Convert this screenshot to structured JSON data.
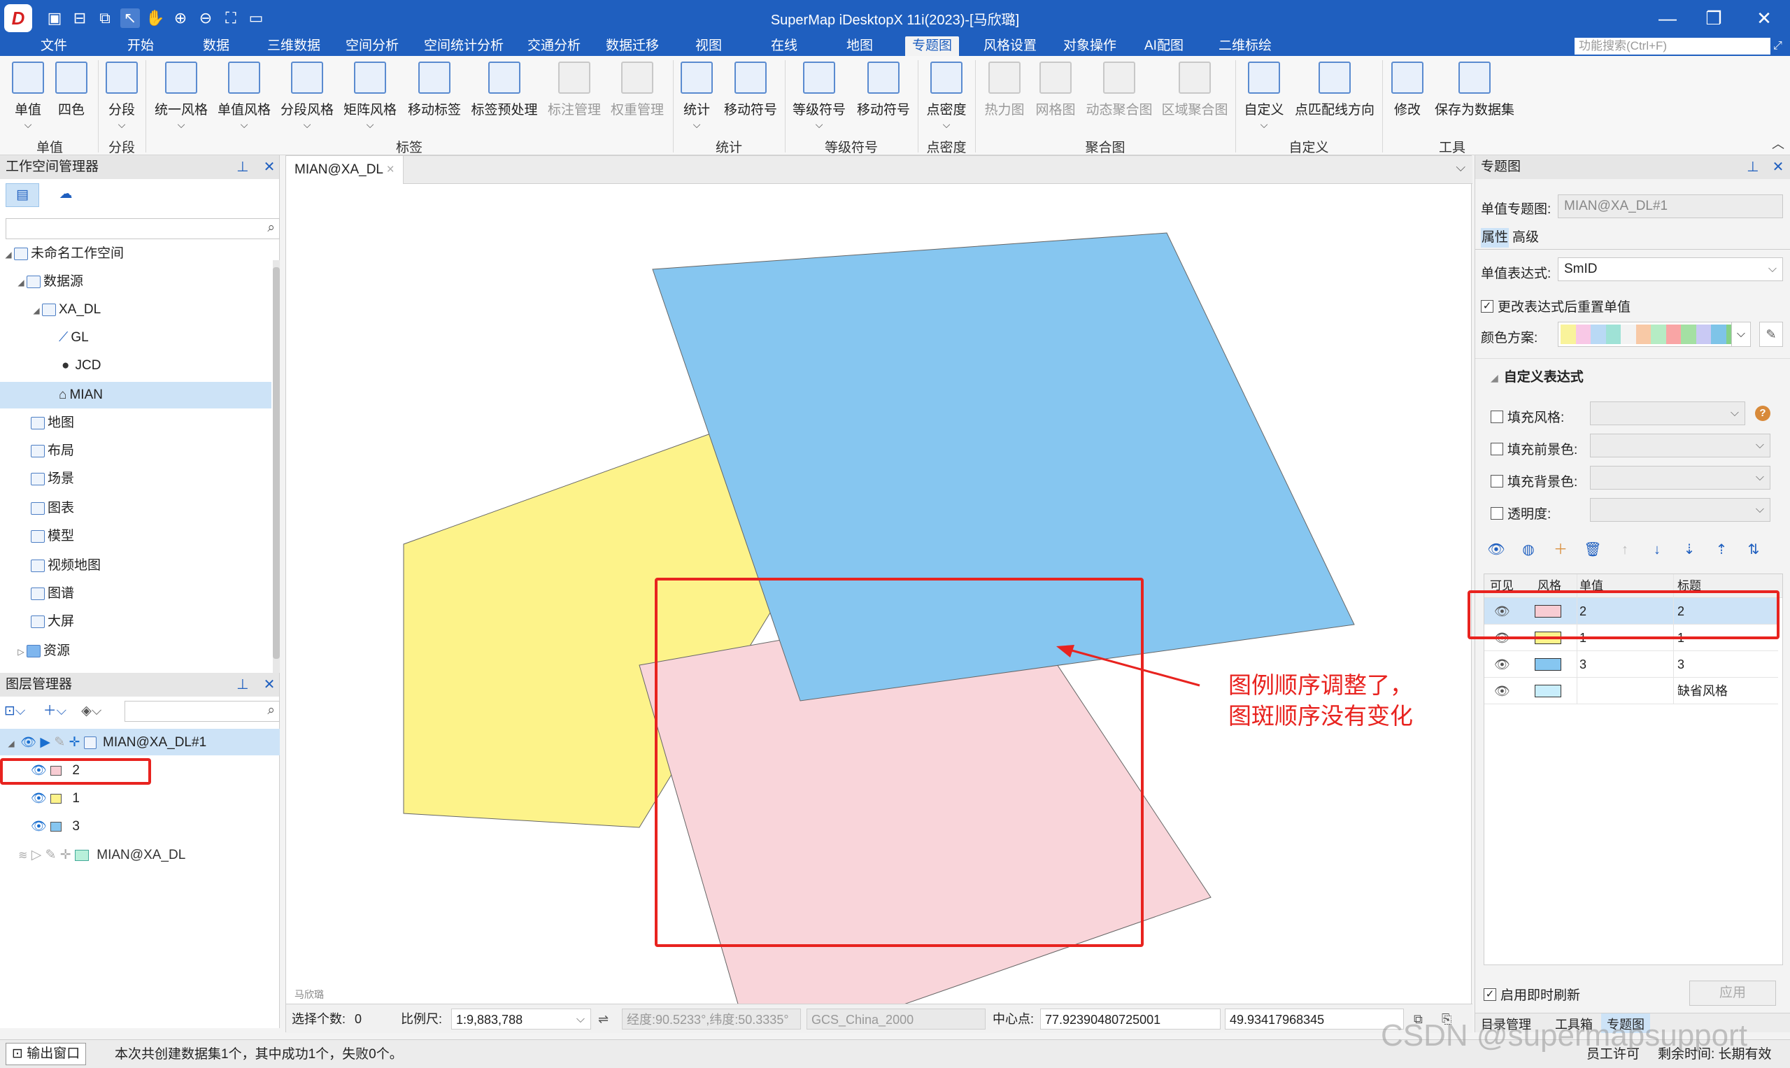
{
  "window": {
    "title": "SuperMap iDesktopX 11i(2023)-[马欣璐]",
    "logo": "D",
    "quick_access_icons": [
      "save-icon",
      "save-as-icon",
      "copy-icon",
      "select-icon",
      "pan-icon",
      "zoom-in-icon",
      "zoom-out-icon",
      "full-extent-icon",
      "open-folder-icon"
    ],
    "controls": {
      "minimize": "—",
      "maximize": "❐",
      "close": "✕"
    }
  },
  "menu": {
    "items": [
      "文件",
      "开始",
      "数据",
      "三维数据",
      "空间分析",
      "空间统计分析",
      "交通分析",
      "数据迁移",
      "视图",
      "在线",
      "地图",
      "专题图",
      "风格设置",
      "对象操作",
      "AI配图",
      "二维标绘"
    ],
    "active": "专题图",
    "search_placeholder": "功能搜索(Ctrl+F)"
  },
  "ribbon": {
    "buttons": [
      {
        "label": "单值",
        "icon": "unique-value-icon",
        "arrow": true
      },
      {
        "label": "四色",
        "icon": "four-color-icon",
        "arrow": false
      },
      {
        "label": "分段",
        "icon": "range-icon",
        "arrow": true
      },
      {
        "label": "统一风格",
        "icon": "uniform-label-icon",
        "arrow": true
      },
      {
        "label": "单值风格",
        "icon": "unique-label-icon",
        "arrow": true
      },
      {
        "label": "分段风格",
        "icon": "range-label-icon",
        "arrow": true
      },
      {
        "label": "矩阵风格",
        "icon": "matrix-label-icon",
        "arrow": true
      },
      {
        "label": "移动标签",
        "icon": "move-label-icon",
        "arrow": false
      },
      {
        "label": "标签预处理",
        "icon": "label-preprocess-icon",
        "arrow": false
      },
      {
        "label": "标注管理",
        "icon": "annotation-manage-icon",
        "arrow": false,
        "disabled": true
      },
      {
        "label": "权重管理",
        "icon": "weight-manage-icon",
        "arrow": false,
        "disabled": true
      },
      {
        "label": "统计",
        "icon": "graph-icon",
        "arrow": true
      },
      {
        "label": "移动符号",
        "icon": "move-graph-icon",
        "arrow": false
      },
      {
        "label": "等级符号",
        "icon": "graduated-symbol-icon",
        "arrow": true
      },
      {
        "label": "移动符号",
        "icon": "move-symbol-icon",
        "arrow": false
      },
      {
        "label": "点密度",
        "icon": "dot-density-icon",
        "arrow": true
      },
      {
        "label": "热力图",
        "icon": "heatmap-icon",
        "arrow": false,
        "disabled": true
      },
      {
        "label": "网格图",
        "icon": "grid-aggregation-icon",
        "arrow": false,
        "disabled": true
      },
      {
        "label": "动态聚合图",
        "icon": "dynamic-aggregation-icon",
        "arrow": false,
        "disabled": true
      },
      {
        "label": "区域聚合图",
        "icon": "region-aggregation-icon",
        "arrow": false,
        "disabled": true
      },
      {
        "label": "自定义",
        "icon": "custom-icon",
        "arrow": true
      },
      {
        "label": "点匹配线方向",
        "icon": "point-line-direction-icon",
        "arrow": false
      },
      {
        "label": "修改",
        "icon": "modify-icon",
        "arrow": false
      },
      {
        "label": "保存为数据集",
        "icon": "save-dataset-icon",
        "arrow": false
      }
    ],
    "groups": [
      "单值",
      "分段",
      "标签",
      "统计",
      "等级符号",
      "点密度",
      "聚合图",
      "自定义",
      "工具"
    ]
  },
  "workspace_panel": {
    "title": "工作空间管理器",
    "tree": [
      {
        "label": "未命名工作空间",
        "icon": "workspace-icon",
        "level": 0,
        "expanded": true
      },
      {
        "label": "数据源",
        "icon": "datasource-icon",
        "level": 1,
        "expanded": true
      },
      {
        "label": "XA_DL",
        "icon": "udbx-icon",
        "level": 2,
        "expanded": true
      },
      {
        "label": "GL",
        "icon": "line-dataset-icon",
        "level": 3
      },
      {
        "label": "JCD",
        "icon": "point-dataset-icon",
        "level": 3
      },
      {
        "label": "MIAN",
        "icon": "region-dataset-icon",
        "level": 3,
        "selected": true
      },
      {
        "label": "地图",
        "icon": "map-icon",
        "level": 1
      },
      {
        "label": "布局",
        "icon": "layout-icon",
        "level": 1
      },
      {
        "label": "场景",
        "icon": "scene-icon",
        "level": 1
      },
      {
        "label": "图表",
        "icon": "chart-icon",
        "level": 1
      },
      {
        "label": "模型",
        "icon": "model-icon",
        "level": 1
      },
      {
        "label": "视频地图",
        "icon": "video-map-icon",
        "level": 1
      },
      {
        "label": "图谱",
        "icon": "graph-map-icon",
        "level": 1
      },
      {
        "label": "大屏",
        "icon": "dashboard-icon",
        "level": 1
      },
      {
        "label": "资源",
        "icon": "resource-folder-icon",
        "level": 1,
        "collapsed": true
      }
    ]
  },
  "layer_panel": {
    "title": "图层管理器",
    "layers": [
      {
        "label": "MIAN@XA_DL#1",
        "kind": "theme",
        "selected": true
      },
      {
        "label": "2",
        "kind": "item",
        "color": "#f8ccd3"
      },
      {
        "label": "1",
        "kind": "item",
        "color": "#fdf38a"
      },
      {
        "label": "3",
        "kind": "item",
        "color": "#86c6f0"
      },
      {
        "label": "MIAN@XA_DL",
        "kind": "dataset"
      }
    ]
  },
  "map": {
    "tab": "MIAN@XA_DL",
    "tab_close": "×",
    "watermark": "马欣璐",
    "polygon_colors": {
      "yellow": "#fdf38a",
      "pink": "#f9d5da",
      "blue": "#86c6f0"
    },
    "status": {
      "selected_label": "选择个数:",
      "selected_value": "0",
      "scale_label": "比例尺:",
      "scale_value": "1:9,883,788",
      "coords": "经度:90.5233°,纬度:50.3335°",
      "crs": "GCS_China_2000",
      "center_label": "中心点:",
      "center_x": "77.92390480725001",
      "center_y": "49.93417968345"
    }
  },
  "theme_panel": {
    "title": "专题图",
    "unique_theme_label": "单值专题图:",
    "unique_theme_value": "MIAN@XA_DL#1",
    "tabs": [
      "属性",
      "高级"
    ],
    "expression_label": "单值表达式:",
    "expression_value": "SmID",
    "reset_checkbox": "更改表达式后重置单值",
    "color_scheme_label": "颜色方案:",
    "color_scheme": [
      "#f9f39b",
      "#f8c8e6",
      "#b9d9f5",
      "#9fe2d6",
      "#f3f3f3",
      "#f8c9a6",
      "#b5ecc4",
      "#f9a5a5",
      "#a4e0a3",
      "#c9c9f4",
      "#7ec4e8",
      "#86d087"
    ],
    "custom_expr_title": "自定义表达式",
    "options": [
      {
        "label": "填充风格:",
        "help": "?"
      },
      {
        "label": "填充前景色:"
      },
      {
        "label": "填充背景色:"
      },
      {
        "label": "透明度:"
      }
    ],
    "toolbar_icons": [
      "visible-toggle-icon",
      "style-icon",
      "add-icon",
      "delete-icon",
      "move-up-icon",
      "move-down-icon",
      "sort-ascending-icon",
      "sort-descending-icon",
      "reverse-icon"
    ],
    "table_headers": [
      "可见",
      "风格",
      "单值",
      "标题"
    ],
    "rows": [
      {
        "value": "2",
        "title": "2",
        "color": "#f8ccd3",
        "selected": true
      },
      {
        "value": "1",
        "title": "1",
        "color": "#fdf38a"
      },
      {
        "value": "3",
        "title": "3",
        "color": "#86c6f0"
      },
      {
        "value": "",
        "title": "缺省风格",
        "color": "#c9eefc"
      }
    ],
    "auto_refresh": "启用即时刷新",
    "apply": "应用",
    "bottom_tabs": [
      "目录管理",
      "工具箱",
      "专题图"
    ]
  },
  "bottom_bar": {
    "output_window": "输出窗口",
    "message": "本次共创建数据集1个，其中成功1个，失败0个。",
    "license": "员工许可",
    "remaining": "剩余时间: 长期有效"
  },
  "annotation": {
    "line1": "图例顺序调整了，",
    "line2": "图斑顺序没有变化",
    "color": "#e8231f"
  },
  "watermark": "CSDN @supermapsupport"
}
